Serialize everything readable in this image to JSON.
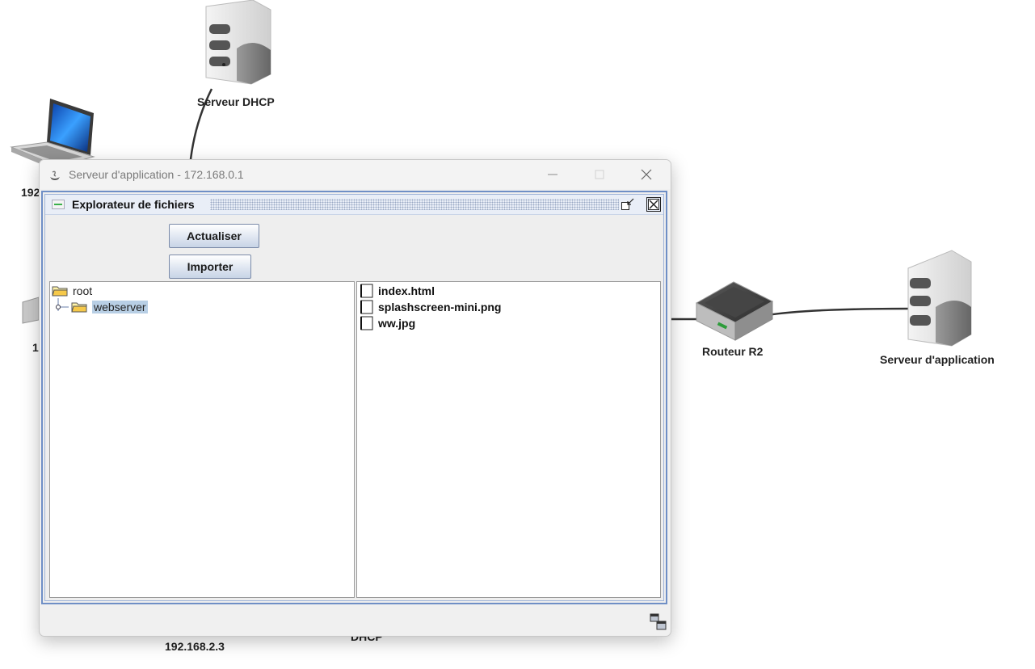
{
  "network": {
    "nodes": {
      "dhcp_server": "Serveur DHCP",
      "laptop_label": "192",
      "left_partial_label": "1",
      "router": "Routeur R2",
      "app_server": "Serveur d'application",
      "bottom_ip": "192.168.2.3",
      "bottom_partial": "DHCP"
    }
  },
  "window": {
    "title": "Serveur d'application - 172.168.0.1",
    "controls": {
      "minimize_icon": "minimize-icon",
      "maximize_icon": "maximize-icon",
      "close_icon": "close-icon"
    }
  },
  "file_explorer": {
    "title": "Explorateur de fichiers",
    "buttons": {
      "refresh": "Actualiser",
      "import": "Importer"
    },
    "tree": [
      {
        "label": "root",
        "level": 0,
        "selected": false
      },
      {
        "label": "webserver",
        "level": 1,
        "selected": true
      }
    ],
    "files": [
      "index.html",
      "splashscreen-mini.png",
      "ww.jpg"
    ]
  }
}
